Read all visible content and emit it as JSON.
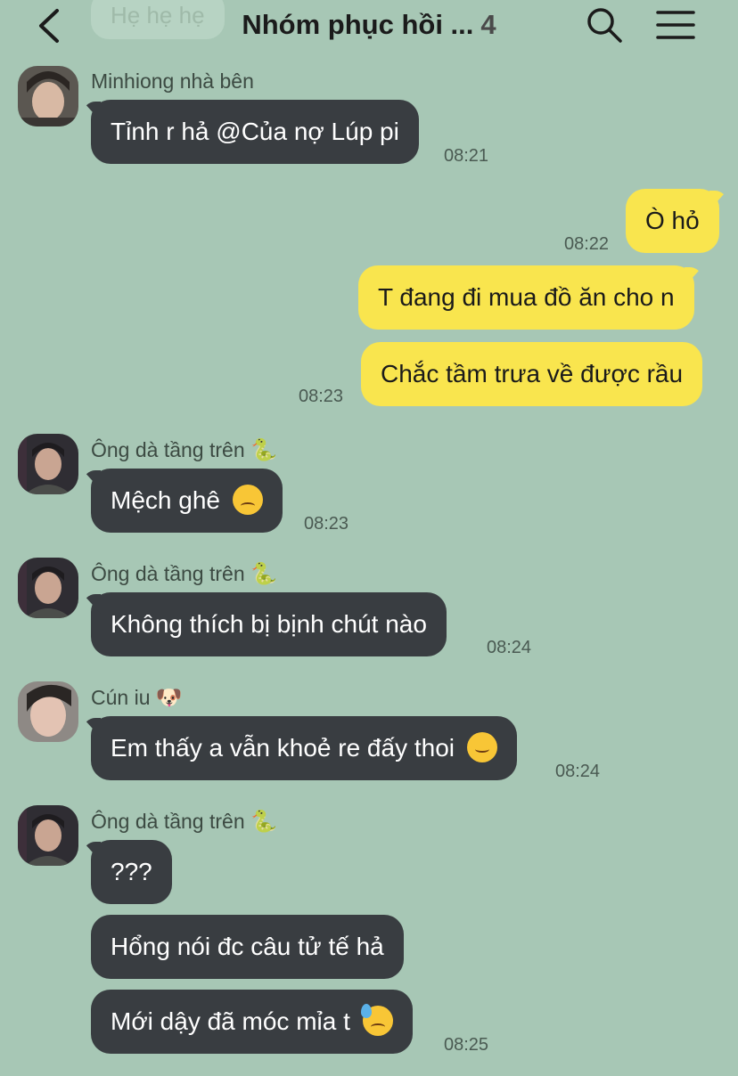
{
  "header": {
    "previous_bubble_text": "Hẹ hẹ hẹ",
    "title": "Nhóm phục hồi ...",
    "member_count": "4",
    "icons": [
      "chevron-left-icon",
      "search-icon",
      "menu-icon"
    ]
  },
  "messages": [
    {
      "sender": "Minhiong nhà bên",
      "text": "Tỉnh r hả @Của nợ Lúp pi",
      "time": "08:21"
    },
    {
      "sender": "me",
      "text": "Ò hỏ",
      "time": "08:22"
    },
    {
      "sender": "me",
      "text": "T đang đi mua đồ ăn cho n"
    },
    {
      "sender": "me",
      "text": "Chắc tầm trưa về được rầu",
      "time": "08:23"
    },
    {
      "sender": "Ông dà tầng trên",
      "sender_emoji": "🐍",
      "text": "Mệch ghê",
      "emoji": "😔",
      "time": "08:23"
    },
    {
      "sender": "Ông dà tầng trên",
      "sender_emoji": "🐍",
      "text": "Không thích bị bịnh chút nào",
      "time": "08:24"
    },
    {
      "sender": "Cún iu",
      "sender_emoji": "🐶",
      "text": "Em thấy a vẫn khoẻ re đấy thoi",
      "emoji": "☺️",
      "time": "08:24"
    },
    {
      "sender": "Ông dà tầng trên",
      "sender_emoji": "🐍",
      "text": "???"
    },
    {
      "sender": "Ông dà tầng trên",
      "text": "Hổng nói đc câu tử tế hả"
    },
    {
      "sender": "Ông dà tầng trên",
      "text": "Mới dậy đã móc mỉa t",
      "emoji": "😓",
      "time": "08:25"
    }
  ],
  "colors": {
    "background": "#a7c7b5",
    "incoming_bubble": "#393d41",
    "outgoing_bubble": "#f9e54e"
  }
}
